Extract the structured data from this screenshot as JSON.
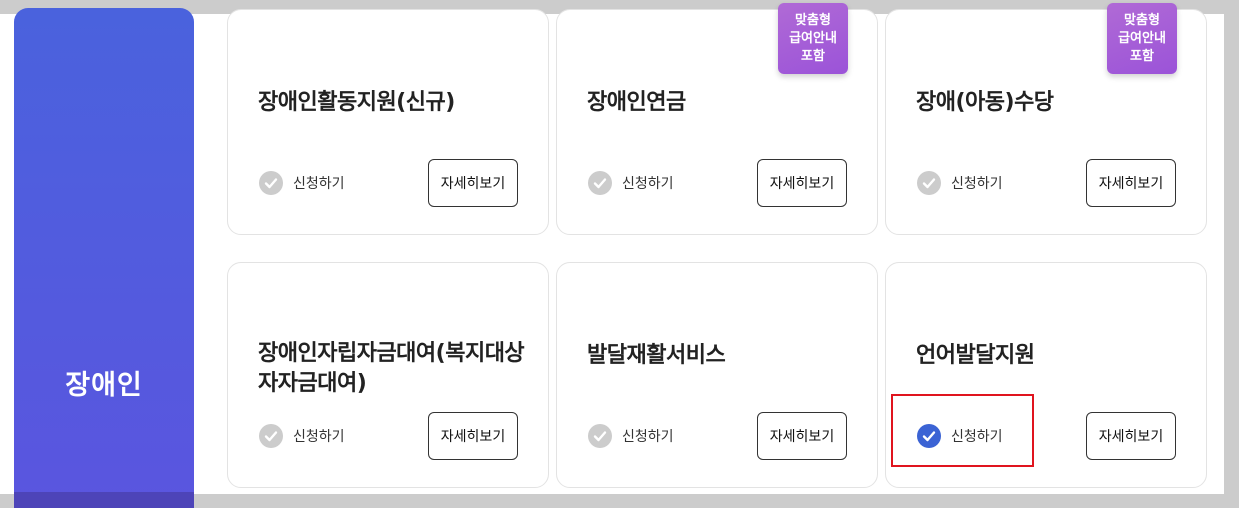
{
  "category": {
    "title": "장애인"
  },
  "cards": [
    {
      "title": "장애인활동지원(신규)",
      "apply_label": "신청하기",
      "detail_label": "자세히보기",
      "checked": false
    },
    {
      "title": "장애인연금",
      "apply_label": "신청하기",
      "detail_label": "자세히보기",
      "checked": false
    },
    {
      "title": "장애(아동)수당",
      "apply_label": "신청하기",
      "detail_label": "자세히보기",
      "checked": false
    },
    {
      "title": "장애인자립자금대여(복지대상자자금대여)",
      "apply_label": "신청하기",
      "detail_label": "자세히보기",
      "checked": false
    },
    {
      "title": "발달재활서비스",
      "apply_label": "신청하기",
      "detail_label": "자세히보기",
      "checked": false
    },
    {
      "title": "언어발달지원",
      "apply_label": "신청하기",
      "detail_label": "자세히보기",
      "checked": true
    }
  ],
  "badges": [
    {
      "line1": "맞춤형",
      "line2": "급여안내",
      "line3": "포함"
    },
    {
      "line1": "맞춤형",
      "line2": "급여안내",
      "line3": "포함"
    }
  ],
  "colors": {
    "accent": "#3b63d4",
    "highlight": "#e0141e",
    "badge": "#a85fd8",
    "category": "#4f5ade"
  }
}
